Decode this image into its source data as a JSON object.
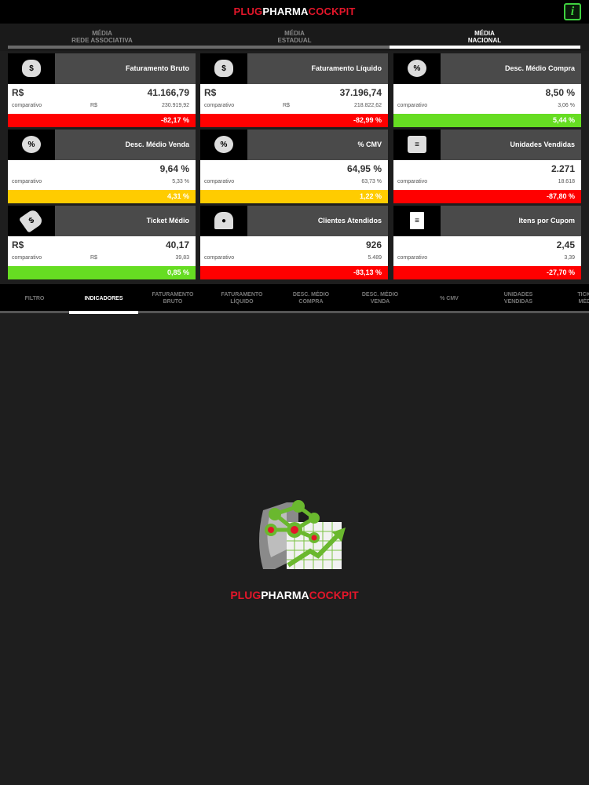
{
  "brand": {
    "plug": "PLUG",
    "pharma": "PHARMA",
    "cockpit": "COCKPIT"
  },
  "info_button": "i",
  "scopes": [
    {
      "line1": "MÉDIA",
      "line2": "REDE ASSOCIATIVA",
      "active": false
    },
    {
      "line1": "MÉDIA",
      "line2": "ESTADUAL",
      "active": false
    },
    {
      "line1": "MÉDIA",
      "line2": "NACIONAL",
      "active": true
    }
  ],
  "cards": [
    {
      "icon": "money-bag-icon",
      "icon_glyph": "$",
      "title": "Faturamento Bruto",
      "currency": "R$",
      "value": "41.166,79",
      "comp_label": "comparativo",
      "comp_currency": "R$",
      "comp_value": "230.919,92",
      "delta": "-82,17 %",
      "status": "red"
    },
    {
      "icon": "money-bag-icon",
      "icon_glyph": "$",
      "title": "Faturamento Líquido",
      "currency": "R$",
      "value": "37.196,74",
      "comp_label": "comparativo",
      "comp_currency": "R$",
      "comp_value": "218.822,62",
      "delta": "-82,99 %",
      "status": "red"
    },
    {
      "icon": "percent-seal-icon",
      "icon_glyph": "%",
      "title": "Desc. Médio Compra",
      "currency": "",
      "value": "8,50 %",
      "comp_label": "comparativo",
      "comp_currency": "",
      "comp_value": "3,06 %",
      "delta": "5,44 %",
      "status": "green"
    },
    {
      "icon": "percent-seal-icon",
      "icon_glyph": "%",
      "title": "Desc. Médio Venda",
      "currency": "",
      "value": "9,64 %",
      "comp_label": "comparativo",
      "comp_currency": "",
      "comp_value": "5,33 %",
      "delta": "4,31 %",
      "status": "yellow"
    },
    {
      "icon": "percent-seal-icon",
      "icon_glyph": "%",
      "title": "% CMV",
      "currency": "",
      "value": "64,95 %",
      "comp_label": "comparativo",
      "comp_currency": "",
      "comp_value": "63,73 %",
      "delta": "1,22 %",
      "status": "yellow"
    },
    {
      "icon": "product-stack-icon",
      "icon_glyph": "≡",
      "title": "Unidades Vendidas",
      "currency": "",
      "value": "2.271",
      "comp_label": "comparativo",
      "comp_currency": "",
      "comp_value": "18.618",
      "delta": "-87,80 %",
      "status": "red"
    },
    {
      "icon": "price-tag-icon",
      "icon_glyph": "$",
      "title": "Ticket Médio",
      "currency": "R$",
      "value": "40,17",
      "comp_label": "comparativo",
      "comp_currency": "R$",
      "comp_value": "39,83",
      "delta": "0,85 %",
      "status": "green"
    },
    {
      "icon": "customers-icon",
      "icon_glyph": "●",
      "title": "Clientes Atendidos",
      "currency": "",
      "value": "926",
      "comp_label": "comparativo",
      "comp_currency": "",
      "comp_value": "5.489",
      "delta": "-83,13 %",
      "status": "red"
    },
    {
      "icon": "receipt-icon",
      "icon_glyph": "≡",
      "title": "Itens por Cupom",
      "currency": "",
      "value": "2,45",
      "comp_label": "comparativo",
      "comp_currency": "",
      "comp_value": "3,39",
      "delta": "-27,70 %",
      "status": "red"
    }
  ],
  "nav": [
    {
      "line1": "FILTRO",
      "line2": "",
      "active": false
    },
    {
      "line1": "INDICADORES",
      "line2": "",
      "active": true
    },
    {
      "line1": "FATURAMENTO",
      "line2": "BRUTO",
      "active": false
    },
    {
      "line1": "FATURAMENTO",
      "line2": "LÍQUIDO",
      "active": false
    },
    {
      "line1": "DESC. MÉDIO",
      "line2": "COMPRA",
      "active": false
    },
    {
      "line1": "DESC. MÉDIO",
      "line2": "VENDA",
      "active": false
    },
    {
      "line1": "% CMV",
      "line2": "",
      "active": false
    },
    {
      "line1": "UNIDADES",
      "line2": "VENDIDAS",
      "active": false
    },
    {
      "line1": "TICKET",
      "line2": "MÉDIO",
      "active": false
    }
  ],
  "logo": {
    "plug": "PLUG",
    "pharma": "PHARMA",
    "cockpit": "COCKPIT"
  },
  "colors": {
    "red": "#ff0000",
    "green": "#66dd22",
    "yellow": "#ffcc00",
    "brand_red": "#e3162a",
    "info_green": "#3fd13f"
  }
}
